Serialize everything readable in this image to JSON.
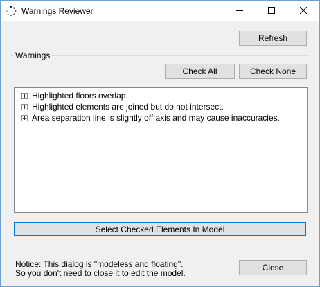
{
  "window": {
    "title": "Warnings Reviewer",
    "icons": {
      "app": "spinner-icon",
      "minimize": "minimize-icon",
      "maximize": "maximize-icon",
      "close": "close-icon"
    },
    "accent_color": "#0078d7"
  },
  "toolbar": {
    "refresh_label": "Refresh"
  },
  "warnings_group": {
    "label": "Warnings",
    "check_all_label": "Check All",
    "check_none_label": "Check None",
    "items": [
      {
        "label": "Highlighted floors overlap.",
        "expander_icon": "expand-plus-icon"
      },
      {
        "label": "Highlighted elements are joined but do not intersect.",
        "expander_icon": "expand-plus-icon"
      },
      {
        "label": "Area separation line is slightly off axis and may cause inaccuracies.",
        "expander_icon": "expand-plus-icon"
      }
    ],
    "select_label": "Select Checked Elements In Model"
  },
  "footer": {
    "notice_line1": "Notice: This dialog is \"modeless and floating\".",
    "notice_line2": "So you don't need to close it to edit the model.",
    "close_label": "Close"
  }
}
